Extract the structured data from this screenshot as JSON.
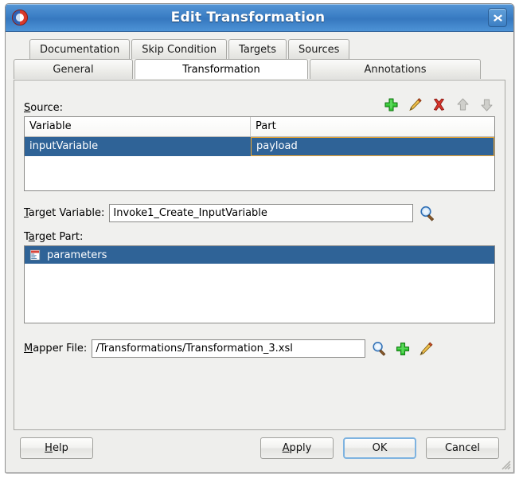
{
  "window": {
    "title": "Edit Transformation",
    "app_icon": "oracle-jdeveloper-icon",
    "close_label": "✖"
  },
  "tabs": {
    "row1": [
      {
        "label": "Documentation",
        "selected": false
      },
      {
        "label": "Skip Condition",
        "selected": false
      },
      {
        "label": "Targets",
        "selected": false
      },
      {
        "label": "Sources",
        "selected": false
      }
    ],
    "row2": [
      {
        "label": "General",
        "selected": false
      },
      {
        "label": "Transformation",
        "selected": true
      },
      {
        "label": "Annotations",
        "selected": false
      }
    ]
  },
  "source": {
    "label": "Source:",
    "label_mnemonic": "S",
    "label_rest": "ource:",
    "toolbar": [
      {
        "name": "add-icon",
        "title": "Add",
        "enabled": true
      },
      {
        "name": "edit-icon",
        "title": "Edit",
        "enabled": true
      },
      {
        "name": "delete-icon",
        "title": "Delete",
        "enabled": true
      },
      {
        "name": "move-up-icon",
        "title": "Move Up",
        "enabled": false
      },
      {
        "name": "move-down-icon",
        "title": "Move Down",
        "enabled": false
      }
    ],
    "columns": [
      "Variable",
      "Part"
    ],
    "rows": [
      {
        "variable": "inputVariable",
        "part": "payload",
        "selected": true,
        "part_focused": true
      }
    ]
  },
  "target_variable": {
    "label_mnemonic": "T",
    "label_rest": "arget Variable:",
    "value": "Invoke1_Create_InputVariable",
    "browse_icon": "magnifier-icon"
  },
  "target_part": {
    "label_mnemonic": "a",
    "label_pre": "T",
    "label_rest": "rget Part:",
    "items": [
      {
        "label": "parameters",
        "icon": "schema-part-icon",
        "selected": true
      }
    ]
  },
  "mapper_file": {
    "label_pre": "",
    "label_mnemonic": "M",
    "label_rest": "apper File:",
    "value": "/Transformations/Transformation_3.xsl",
    "actions": [
      {
        "name": "magnifier-icon",
        "title": "Browse"
      },
      {
        "name": "add-icon",
        "title": "Create"
      },
      {
        "name": "edit-icon",
        "title": "Edit"
      }
    ]
  },
  "footer": {
    "help": {
      "mnemonic": "H",
      "rest": "elp",
      "full": "Help"
    },
    "apply": {
      "mnemonic": "A",
      "rest": "pply",
      "full": "Apply"
    },
    "ok": {
      "full": "OK",
      "default": true
    },
    "cancel": {
      "full": "Cancel"
    }
  },
  "colors": {
    "titlebar_blue": "#3d80c6",
    "selection_blue": "#2f6397",
    "focus_orange": "#f0a830",
    "dialog_bg": "#f0f0ee",
    "default_button_border": "#7eb3e0"
  }
}
